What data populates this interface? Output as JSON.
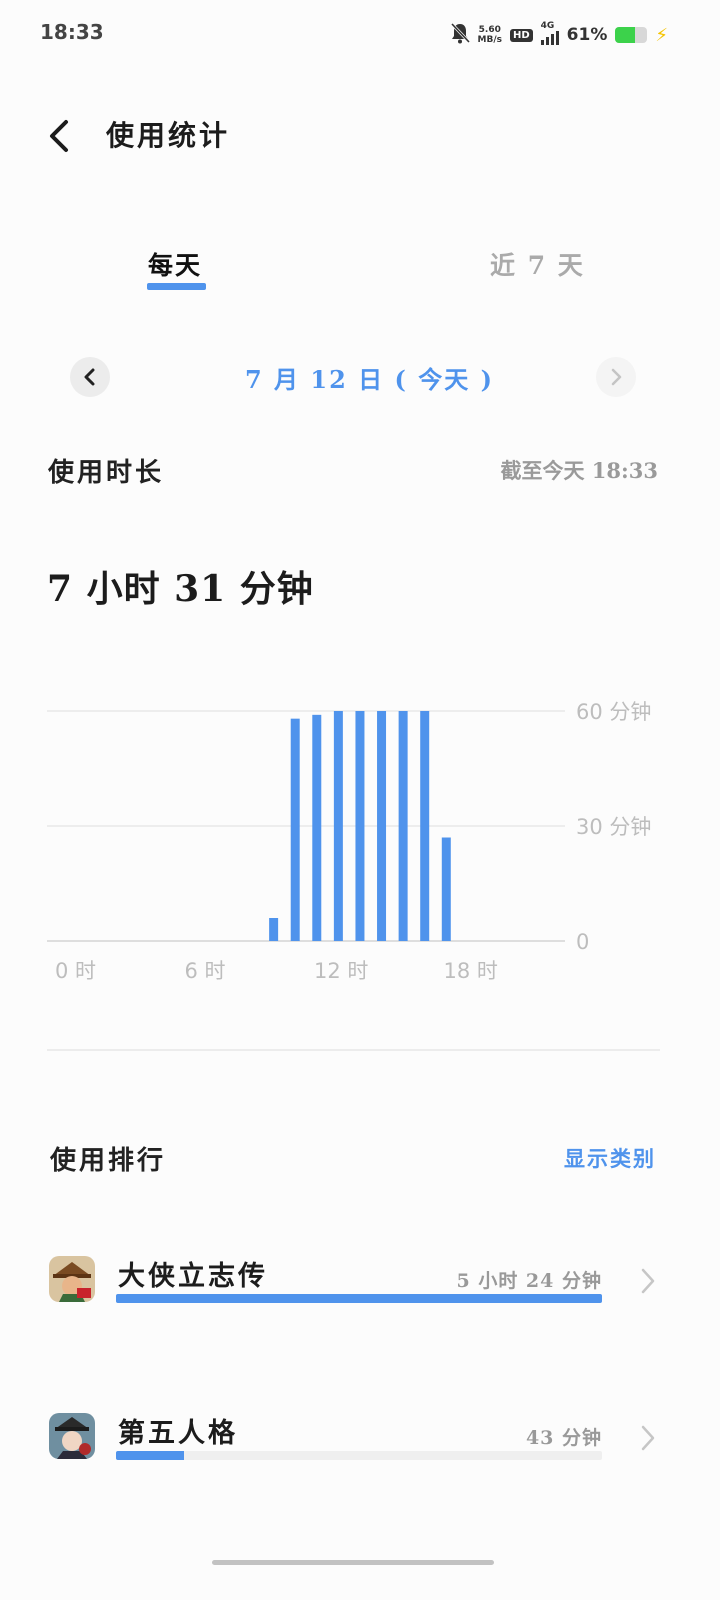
{
  "status_bar": {
    "time": "18:33",
    "net_speed_value": "5.60",
    "net_speed_unit": "MB/s",
    "hd_badge": "HD",
    "network_type": "4G",
    "battery_percent_label": "61%",
    "battery_level": 0.61,
    "icons": [
      "bell-muted-icon",
      "signal-icon",
      "battery-icon",
      "charging-bolt-icon"
    ]
  },
  "header": {
    "title": "使用统计",
    "back_icon": "chevron-left-icon"
  },
  "tabs": [
    {
      "label": "每天",
      "active": true
    },
    {
      "label": "近 7 天",
      "active": false
    }
  ],
  "date_nav": {
    "label": "7 月 12 日 ( 今天 )",
    "prev_icon": "chevron-left-icon",
    "next_icon": "chevron-right-icon"
  },
  "usage": {
    "label": "使用时长",
    "as_of": "截至今天 18:33",
    "total": "7 小时 31 分钟"
  },
  "chart_data": {
    "type": "bar",
    "x_ticks": [
      "0 时",
      "6 时",
      "12 时",
      "18 时"
    ],
    "y_ticks": [
      "0",
      "30 分钟",
      "60 分钟"
    ],
    "ylim": [
      0,
      60
    ],
    "bars": [
      {
        "hour": 10,
        "value": 6
      },
      {
        "hour": 11,
        "value": 58
      },
      {
        "hour": 12,
        "value": 59
      },
      {
        "hour": 13,
        "value": 60
      },
      {
        "hour": 14,
        "value": 60
      },
      {
        "hour": 15,
        "value": 60
      },
      {
        "hour": 16,
        "value": 60
      },
      {
        "hour": 17,
        "value": 60
      },
      {
        "hour": 18,
        "value": 27
      }
    ],
    "bar_color": "#4f93ec",
    "grid": true
  },
  "ranking": {
    "label": "使用排行",
    "show_category": "显示类别",
    "apps": [
      {
        "name": "大侠立志传",
        "time": "5 小时 24 分钟",
        "fraction": 1.0,
        "icon": "wuxia-game-app-icon"
      },
      {
        "name": "第五人格",
        "time": "43 分钟",
        "fraction": 0.14,
        "icon": "identity-v-app-icon"
      }
    ]
  },
  "colors": {
    "accent": "#4f93ec",
    "inactive_text": "#aaaaaa",
    "divider": "#ececec"
  }
}
